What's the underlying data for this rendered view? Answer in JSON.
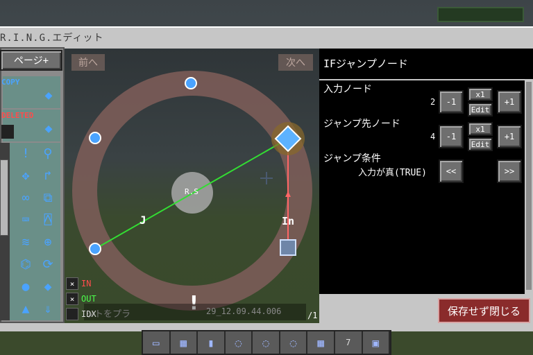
{
  "window": {
    "title": "R.I.N.G.エディット"
  },
  "palette": {
    "page_button": "ページ+",
    "copy_label": "COPY",
    "deleted_label": "DELETED",
    "tools": [
      "exclaim-icon",
      "wand-icon",
      "move-icon",
      "redirect-icon",
      "loop-icon",
      "link-icon",
      "keyboard-icon",
      "mouse-icon",
      "signal-icon",
      "target-icon",
      "robot-icon",
      "rotate-icon",
      "circle-node-icon",
      "diamond-node-icon",
      "triangle-icon",
      "download-icon"
    ]
  },
  "canvas": {
    "prev_label": "前へ",
    "next_label": "次へ",
    "center_label": "R.S",
    "jump_label": "J",
    "input_label": "In",
    "legend": [
      {
        "mark": "×",
        "label": "IN",
        "color": "#ff4c4c"
      },
      {
        "mark": "×",
        "label": "OUT",
        "color": "#4cff4c"
      },
      {
        "mark": "",
        "label": "IDX",
        "color": "#d8d8d8"
      }
    ],
    "page_indicator": "/1",
    "overlay_text": "ットをプラ",
    "overlay_date": "29_12.09.44.006"
  },
  "panel": {
    "node_title": "IFジャンプノード",
    "input_node": {
      "label": "入力ノード",
      "value": "2",
      "minus": "-1",
      "mult": "x1",
      "edit": "Edit",
      "plus": "+1"
    },
    "jump_node": {
      "label": "ジャンプ先ノード",
      "value": "4",
      "minus": "-1",
      "mult": "x1",
      "edit": "Edit",
      "plus": "+1"
    },
    "condition": {
      "label": "ジャンプ条件",
      "value": "入力が真(TRUE)",
      "prev": "<<",
      "next": ">>"
    }
  },
  "save_button": "保存せず閉じる",
  "hotbar": {
    "slot_count": 9,
    "selected_count": "7"
  },
  "colors": {
    "ring": "#7b5c58",
    "jump_line": "#33dd33",
    "input_line": "#ff6666",
    "node": "#4aa3ff",
    "save_bg": "#8a2b2b"
  }
}
